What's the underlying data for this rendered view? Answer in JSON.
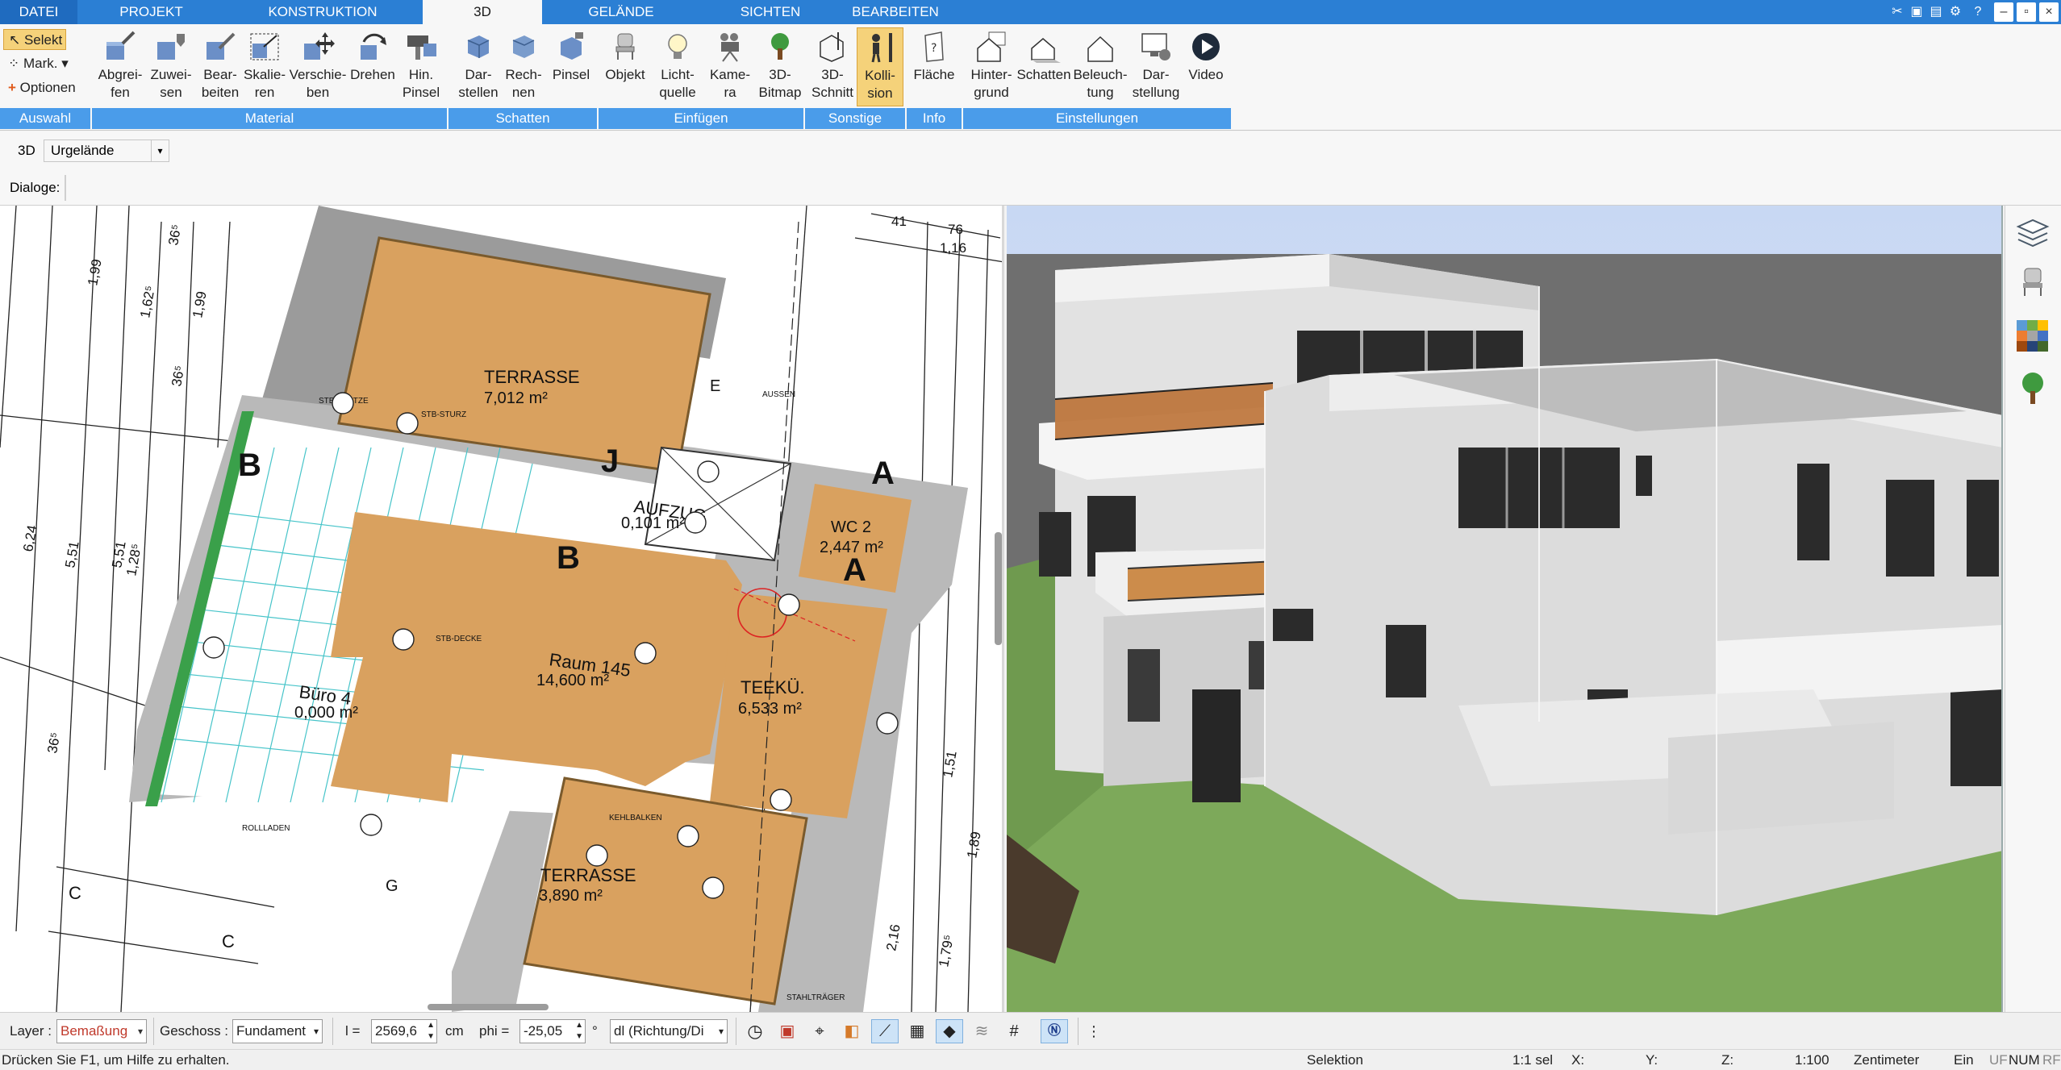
{
  "tabs": [
    "DATEI",
    "PROJEKT",
    "KONSTRUKTION",
    "3D",
    "GELÄNDE",
    "SICHTEN",
    "BEARBEITEN"
  ],
  "auswahl": {
    "selekt": "Selekt",
    "mark": "Mark.",
    "optionen": "Optionen",
    "group": "Auswahl"
  },
  "groups": {
    "material": "Material",
    "schatten": "Schatten",
    "einfuegen": "Einfügen",
    "sonstige": "Sonstige",
    "info": "Info",
    "einstellungen": "Einstellungen"
  },
  "buttons": {
    "abgreifen": "Abgrei-\nfen",
    "zuweisen": "Zuwei-\nsen",
    "bearbeiten": "Bear-\nbeiten",
    "skalieren": "Skalie-\nren",
    "verschieben": "Verschie-\nben",
    "drehen": "Drehen",
    "hinpinsel": "Hin.\nPinsel",
    "darstellen": "Dar-\nstellen",
    "rechnen": "Rech-\nnen",
    "pinsel": "Pinsel",
    "objekt": "Objekt",
    "lichtquelle": "Licht-\nquelle",
    "kamera": "Kame-\nra",
    "bitmap": "3D-\nBitmap",
    "schnitt": "3D-\nSchnitt",
    "kollision": "Kolli-\nsion",
    "flaeche": "Fläche",
    "hintergrund": "Hinter-\ngrund",
    "schatten_btn": "Schatten",
    "beleuchtung": "Beleuch-\ntung",
    "darstellung": "Dar-\nstellung",
    "video": "Video"
  },
  "bar3d": {
    "label": "3D",
    "select": "Urgelände"
  },
  "dialogs": {
    "label": "Dialoge:"
  },
  "plan": {
    "rooms": [
      {
        "name": "TERRASSE",
        "area": "7,012 m²"
      },
      {
        "name": "AUFZUG",
        "area": "0,101 m²"
      },
      {
        "name": "WC 2",
        "area": "2,447 m²"
      },
      {
        "name": "Raum 145",
        "area": "14,600 m²"
      },
      {
        "name": "TEEKÜ.",
        "area": "6,533 m²"
      },
      {
        "name": "Büro 4",
        "area": "0,000 m²"
      },
      {
        "name": "TERRASSE",
        "area": "3,890 m²"
      }
    ],
    "dims": [
      "1,99",
      "1,62⁵",
      "1,99",
      "36⁵",
      "36⁵",
      "6,24",
      "5,51",
      "5,51",
      "1,28⁵",
      "36⁵",
      "41",
      "76",
      "1,16",
      "1,51",
      "1,89",
      "2,16",
      "1,79⁵"
    ],
    "sections": [
      "B",
      "B",
      "J",
      "A",
      "A",
      "C",
      "C",
      "E",
      "G"
    ],
    "notes": [
      "STB-STÜTZE",
      "STB-STURZ",
      "STB-DECKE",
      "KEHLBALKEN",
      "STAHLTRÄGER",
      "AUSSEN",
      "ROLLLADEN"
    ]
  },
  "options": {
    "layer_label": "Layer :",
    "layer_value": "Bemaßung",
    "geschoss_label": "Geschoss :",
    "geschoss_value": "Fundament",
    "l_label": "l =",
    "l_value": "2569,6",
    "l_unit": "cm",
    "phi_label": "phi =",
    "phi_value": "-25,05",
    "phi_unit": "°",
    "dl_value": "dl (Richtung/Di"
  },
  "status": {
    "help": "Drücken Sie F1, um Hilfe zu erhalten.",
    "mode": "Selektion",
    "sel": "1:1 sel",
    "x": "X:",
    "y": "Y:",
    "z": "Z:",
    "scale": "1:100",
    "unit": "Zentimeter",
    "ein": "Ein",
    "uf": "UF",
    "num": "NUM",
    "rf": "RF"
  },
  "colors": {
    "tabbar": "#2b7fd4",
    "grouplabel": "#4a9cea",
    "wood": "#d9a15f",
    "grass": "#7a9e5e"
  }
}
